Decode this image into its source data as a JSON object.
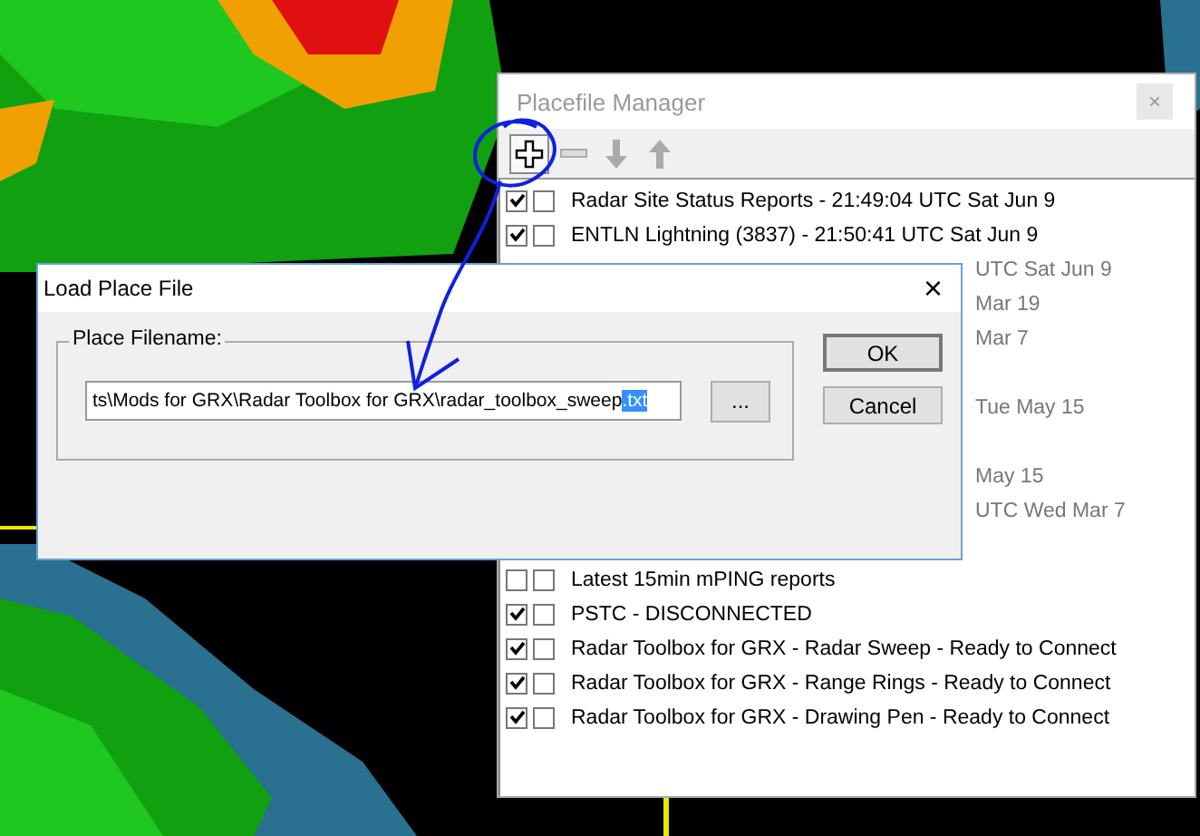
{
  "manager": {
    "title": "Placefile Manager",
    "close": "×",
    "toolbar": [
      {
        "kind": "add",
        "pressed": true,
        "disabled": false
      },
      {
        "kind": "remove",
        "pressed": false,
        "disabled": true
      },
      {
        "kind": "down",
        "pressed": false,
        "disabled": true
      },
      {
        "kind": "up",
        "pressed": false,
        "disabled": true
      }
    ],
    "rows": [
      {
        "kind": "full",
        "text": "Radar Site Status Reports - 21:49:04 UTC Sat Jun 9",
        "checked": true,
        "selected": false
      },
      {
        "kind": "full",
        "text": "ENTLN Lightning (3837) - 21:50:41 UTC Sat Jun 9",
        "checked": true,
        "selected": false
      },
      {
        "kind": "covered",
        "text": "UTC Sat Jun 9"
      },
      {
        "kind": "covered",
        "text": "Mar 19"
      },
      {
        "kind": "covered",
        "text": "Mar 7"
      },
      {
        "kind": "hidden"
      },
      {
        "kind": "covered",
        "text": "Tue May 15"
      },
      {
        "kind": "hidden"
      },
      {
        "kind": "covered",
        "text": "May 15"
      },
      {
        "kind": "covered",
        "text": "UTC Wed Mar 7"
      },
      {
        "kind": "hidden"
      },
      {
        "kind": "full",
        "text": "Latest 15min mPING reports",
        "checked": false,
        "selected": false
      },
      {
        "kind": "full",
        "text": "PSTC - DISCONNECTED",
        "checked": true,
        "selected": false
      },
      {
        "kind": "full",
        "text": "Radar Toolbox for GRX - Radar Sweep - Ready to Connect",
        "checked": true,
        "selected": false
      },
      {
        "kind": "full",
        "text": "Radar Toolbox for GRX - Range Rings - Ready to Connect",
        "checked": true,
        "selected": false
      },
      {
        "kind": "full",
        "text": "Radar Toolbox for GRX - Drawing Pen - Ready to Connect",
        "checked": true,
        "selected": false
      }
    ]
  },
  "dialog": {
    "title": "Load Place File",
    "close": "×",
    "group_label": "Place Filename:",
    "filename": "ts\\Mods for GRX\\Radar Toolbox for GRX\\radar_toolbox_sweep",
    "filename_selected": ".txt",
    "browse": "...",
    "buttons": [
      "OK",
      "Cancel"
    ]
  }
}
